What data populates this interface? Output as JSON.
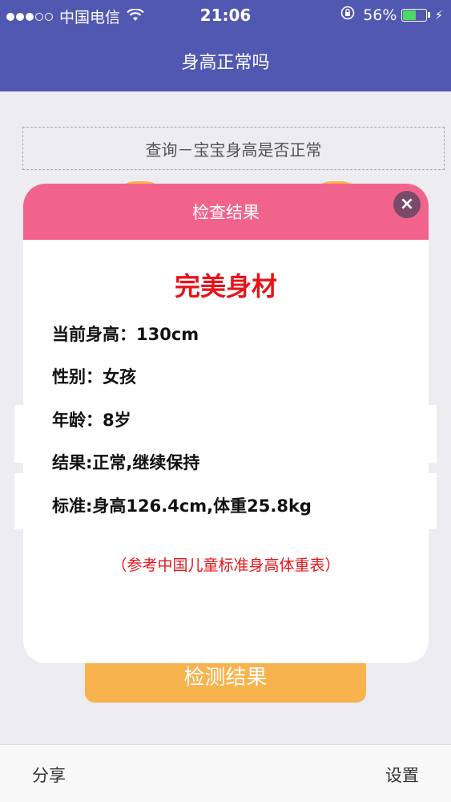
{
  "status_bar": {
    "carrier": "中国电信",
    "time": "21:06",
    "battery_percent": "56%",
    "battery_level": 0.56,
    "signal_bars_filled": 3,
    "signal_bars_total": 5
  },
  "nav": {
    "title": "身高正常吗"
  },
  "page": {
    "query_label": "查询－宝宝身高是否正常",
    "detect_button_label": "检测结果"
  },
  "modal": {
    "header_title": "检查结果",
    "close_symbol": "×",
    "result_title": "完美身材",
    "rows": [
      "当前身高：130cm",
      "性别：女孩",
      "年龄：8岁",
      "结果:正常,继续保持",
      "标准:身高126.4cm,体重25.8kg"
    ],
    "reference_note": "（参考中国儿童标准身高体重表）"
  },
  "bottom_bar": {
    "share_label": "分享",
    "settings_label": "设置"
  },
  "colors": {
    "nav_bg": "#5158b2",
    "modal_header": "#f2638c",
    "accent_red": "#e6141a",
    "button_orange": "#f8b24e",
    "battery_green": "#4cd964"
  }
}
